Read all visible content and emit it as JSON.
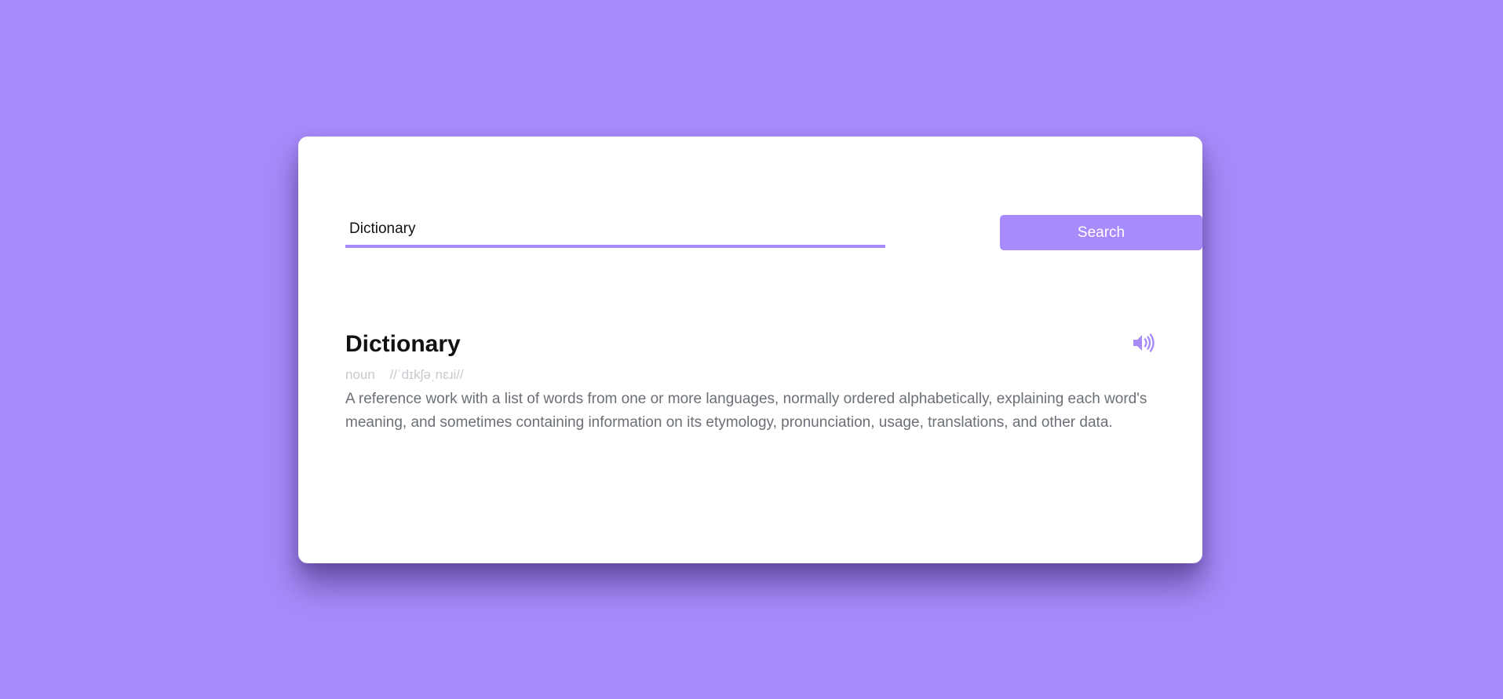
{
  "search": {
    "value": "Dictionary",
    "button_label": "Search"
  },
  "result": {
    "word": "Dictionary",
    "part_of_speech": "noun",
    "phonetic": "//ˈdɪkʃəˌnɛɹi//",
    "definition": "A reference work with a list of words from one or more languages, normally ordered alphabetically, explaining each word's meaning, and sometimes containing information on its etymology, pronunciation, usage, translations, and other data.",
    "sound_icon": "speaker-volume-icon"
  },
  "colors": {
    "accent": "#a78bfa",
    "background": "#a78bfa",
    "card": "#ffffff",
    "definition_text": "#6b6f76",
    "meta_text": "#c9c9cf"
  }
}
